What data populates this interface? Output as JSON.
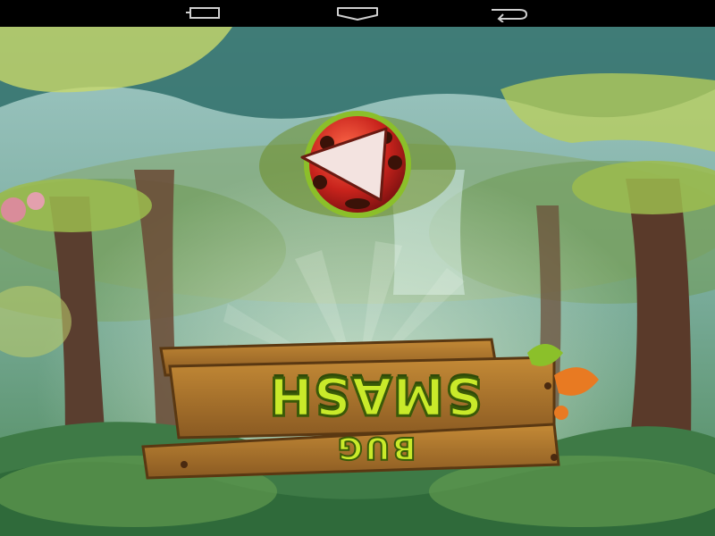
{
  "system_nav": {
    "buttons": [
      {
        "icon": "recent-apps-icon"
      },
      {
        "icon": "home-icon"
      },
      {
        "icon": "back-icon"
      }
    ]
  },
  "game": {
    "logo": {
      "title": "SMASH",
      "subtitle": "BUG"
    },
    "play_button": {
      "icon": "play-icon",
      "color": "#c8231c"
    },
    "colors": {
      "wood": "#a8742c",
      "logo_green": "#c9ea2a",
      "forest": "#5f8a4a"
    }
  }
}
